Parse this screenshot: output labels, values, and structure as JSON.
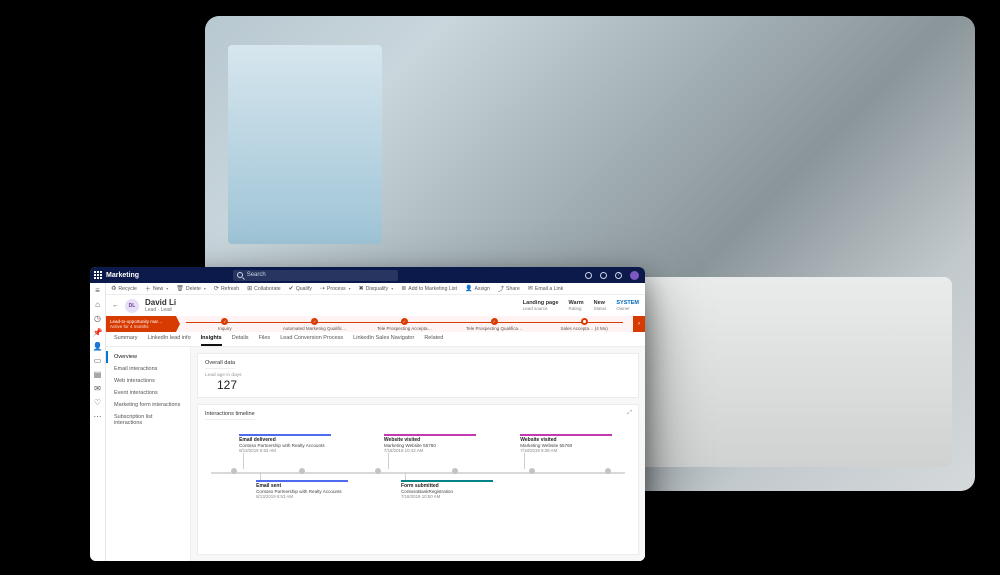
{
  "titlebar": {
    "app_name": "Marketing",
    "search_placeholder": "Search"
  },
  "cmdbar": {
    "recycle": "Recycle",
    "new": "New",
    "delete": "Delete",
    "refresh": "Refresh",
    "collaborate": "Collaborate",
    "qualify": "Qualify",
    "process": "Process",
    "disqualify": "Disqualify",
    "add_list": "Add to Marketing List",
    "assign": "Assign",
    "share": "Share",
    "email_link": "Email a Link"
  },
  "header": {
    "initials": "DL",
    "name": "David Li",
    "subtype": "Lead · Lead",
    "meta": [
      {
        "value": "Landing page",
        "label": "Lead source"
      },
      {
        "value": "Warm",
        "label": "Rating"
      },
      {
        "value": "New",
        "label": "Status"
      },
      {
        "value": "SYSTEM",
        "label": "Owner",
        "sys": true
      }
    ]
  },
  "ribbon": {
    "flag_title": "Lead-to-opportunity mar…",
    "flag_sub": "Active for 4 months",
    "stages": [
      "Inquiry",
      "Automated Marketing Qualific…",
      "Tele Prospecting Accepta…",
      "Tele Prospecting Qualifica…",
      "Sales Accepta… (4 Mo)"
    ],
    "current_index": 4
  },
  "tabs": [
    "Summary",
    "LinkedIn lead info",
    "Insights",
    "Details",
    "Files",
    "Lead Conversion Process",
    "LinkedIn Sales Navigator",
    "Related"
  ],
  "active_tab": 2,
  "side_items": [
    "Overview",
    "Email interactions",
    "Web interactions",
    "Event interactions",
    "Marketing form interactions",
    "Subscription list interactions"
  ],
  "active_side": 0,
  "overall": {
    "title": "Overall data",
    "metric_label": "Lead age in days",
    "metric_value": "127"
  },
  "timeline": {
    "title": "Interactions timeline",
    "events": [
      {
        "pos": 8,
        "row": "above",
        "color": "blue",
        "title": "Email delivered",
        "line": "Contoso Partnership with Realty Accounts",
        "date": "8/13/2019 6:53 AM"
      },
      {
        "pos": 12,
        "row": "below",
        "color": "blue",
        "title": "Email sent",
        "line": "Contoso Partnership with Realty Accounts",
        "date": "8/13/2019 6:53 AM"
      },
      {
        "pos": 42,
        "row": "above",
        "color": "magenta",
        "title": "Website visited",
        "line": "Marketing Website 55760",
        "date": "7/18/2019 10:42 AM"
      },
      {
        "pos": 46,
        "row": "below",
        "color": "teal",
        "title": "Form submitted",
        "line": "ContosoBankRegistration",
        "date": "7/18/2019 10:50 AM"
      },
      {
        "pos": 74,
        "row": "above",
        "color": "magenta",
        "title": "Website visited",
        "line": "Marketing Website 55760",
        "date": "7/18/2019 9:39 AM"
      }
    ],
    "ticks": [
      6,
      22,
      40,
      58,
      76,
      94
    ]
  }
}
